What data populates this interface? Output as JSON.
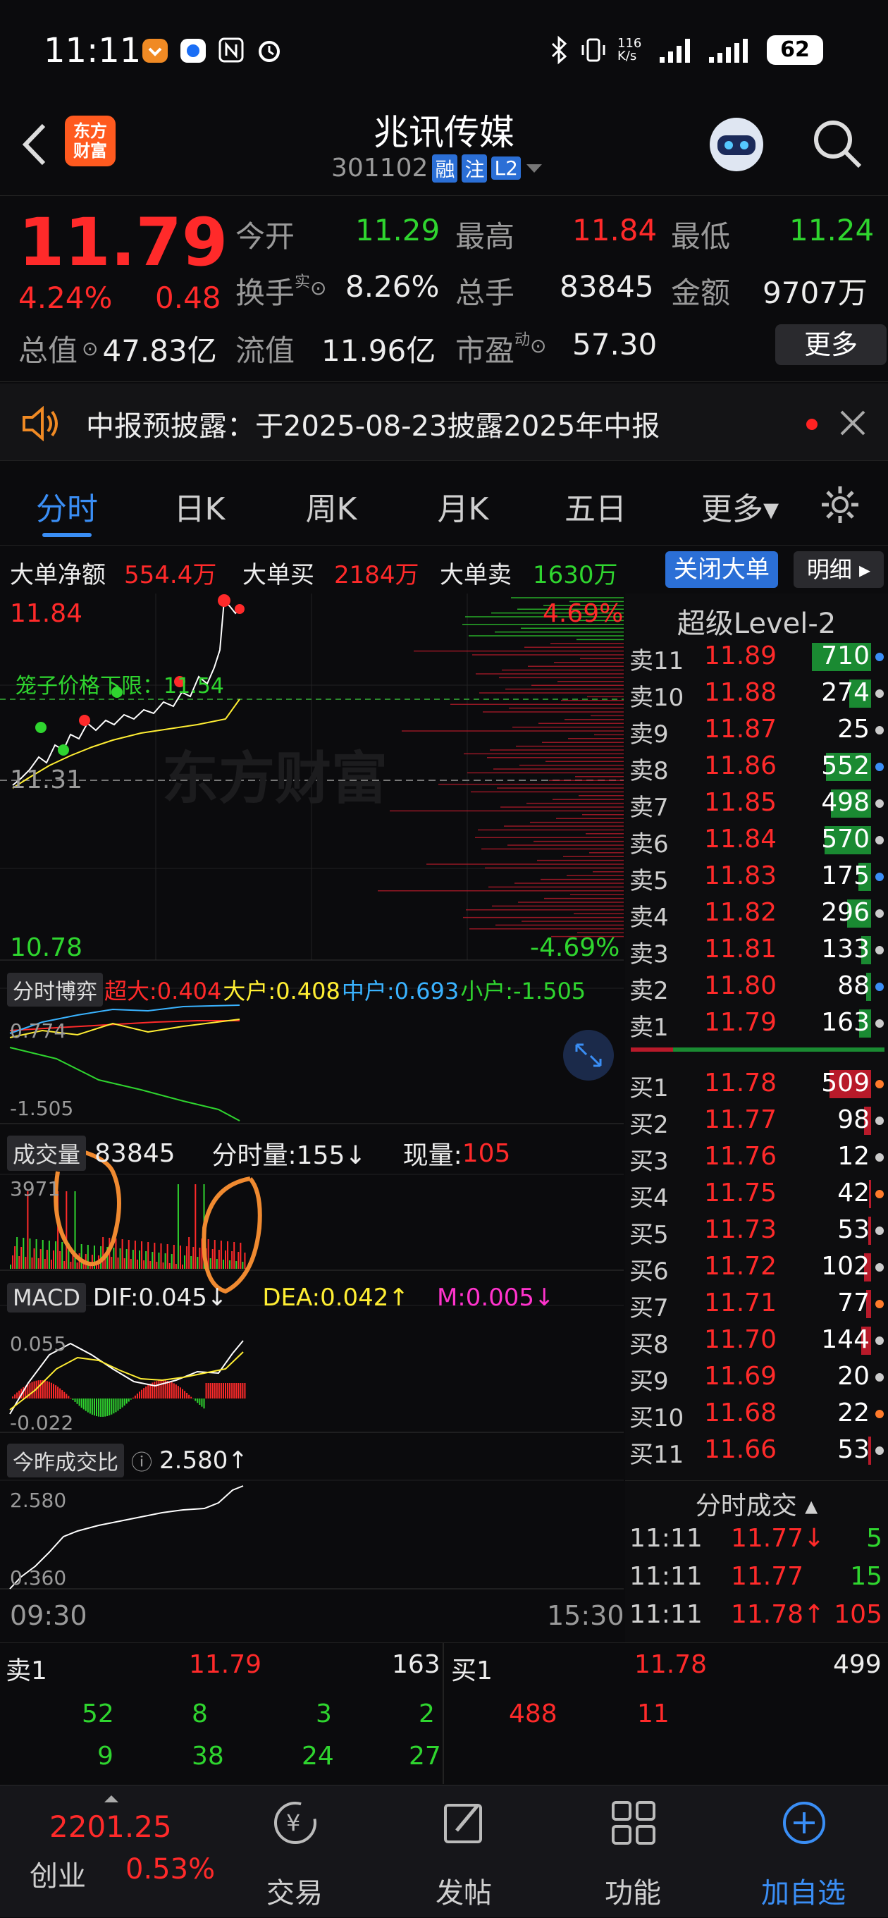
{
  "status": {
    "time": "11:11",
    "net_speed": "116\nK/s",
    "battery": "62"
  },
  "header": {
    "title": "兆讯传媒",
    "code": "301102",
    "tag_margin": "融",
    "tag_note": "注",
    "tag_level": "L2",
    "logo_text_1": "东方",
    "logo_text_2": "财富"
  },
  "quote": {
    "price": "11.79",
    "pct": "4.24%",
    "change": "0.48",
    "open_label": "今开",
    "open": "11.29",
    "high_label": "最高",
    "high": "11.84",
    "low_label": "最低",
    "low": "11.24",
    "turnover_label": "换手",
    "turnover_sup": "实",
    "turnover": "8.26%",
    "volume_label": "总手",
    "volume": "83845",
    "amount_label": "金额",
    "amount": "9707万",
    "mktcap_label": "总值",
    "mktcap": "47.83亿",
    "float_label": "流值",
    "float": "11.96亿",
    "pe_label": "市盈",
    "pe_sup": "动",
    "pe": "57.30",
    "more": "更多"
  },
  "notice": {
    "text": "中报预披露：于2025-08-23披露2025年中报"
  },
  "tabs": [
    "分时",
    "日K",
    "周K",
    "月K",
    "五日",
    "更多▾"
  ],
  "bigorder": {
    "net_label": "大单净额",
    "net": "554.4万",
    "buy_label": "大单买",
    "buy": "2184万",
    "sell_label": "大单卖",
    "sell": "1630万",
    "close_btn": "关闭大单",
    "detail_btn": "明细 ▸"
  },
  "chart": {
    "price_top": "11.84",
    "pct_top": "4.69%",
    "price_bottom": "10.78",
    "pct_bottom": "-4.69%",
    "pre_close": "11.31",
    "cage": "笼子价格下限：11.54",
    "watermark": "东方财富",
    "time_start": "09:30",
    "time_end": "15:30",
    "game_label": "分时博弈",
    "game_super": "超大:0.404",
    "game_big": "大户:0.408",
    "game_mid": "中户:0.693",
    "game_small": "小户:-1.505",
    "game_top": "0.774",
    "game_bottom": "-1.505",
    "vol_label": "成交量",
    "vol_total": "83845",
    "vol_min_label": "分时量:155↓",
    "vol_now_label": "现量:",
    "vol_now": "105",
    "vol_max": "3971",
    "macd_label": "MACD",
    "dif": "DIF:0.045↓",
    "dea": "DEA:0.042↑",
    "m": "M:0.005↓",
    "macd_top": "0.055",
    "macd_bottom": "-0.022",
    "ratio_label": "今昨成交比",
    "ratio": "2.580↑",
    "ratio_top": "2.580",
    "ratio_bottom": "0.360"
  },
  "book": {
    "title": "超级Level-2",
    "asks": [
      {
        "label": "卖11",
        "price": "11.89",
        "vol": "710",
        "pct": 0.6
      },
      {
        "label": "卖10",
        "price": "11.88",
        "vol": "274",
        "pct": 0.22
      },
      {
        "label": "卖9",
        "price": "11.87",
        "vol": "25",
        "pct": 0.0
      },
      {
        "label": "卖8",
        "price": "11.86",
        "vol": "552",
        "pct": 0.46
      },
      {
        "label": "卖7",
        "price": "11.85",
        "vol": "498",
        "pct": 0.41
      },
      {
        "label": "卖6",
        "price": "11.84",
        "vol": "570",
        "pct": 0.47
      },
      {
        "label": "卖5",
        "price": "11.83",
        "vol": "175",
        "pct": 0.13
      },
      {
        "label": "卖4",
        "price": "11.82",
        "vol": "296",
        "pct": 0.24
      },
      {
        "label": "卖3",
        "price": "11.81",
        "vol": "133",
        "pct": 0.1
      },
      {
        "label": "卖2",
        "price": "11.80",
        "vol": "88",
        "pct": 0.05
      },
      {
        "label": "卖1",
        "price": "11.79",
        "vol": "163",
        "pct": 0.12
      }
    ],
    "bids": [
      {
        "label": "买1",
        "price": "11.78",
        "vol": "509",
        "pct": 0.42
      },
      {
        "label": "买2",
        "price": "11.77",
        "vol": "98",
        "pct": 0.07
      },
      {
        "label": "买3",
        "price": "11.76",
        "vol": "12",
        "pct": 0.0
      },
      {
        "label": "买4",
        "price": "11.75",
        "vol": "42",
        "pct": 0.02
      },
      {
        "label": "买5",
        "price": "11.73",
        "vol": "53",
        "pct": 0.03
      },
      {
        "label": "买6",
        "price": "11.72",
        "vol": "102",
        "pct": 0.07
      },
      {
        "label": "买7",
        "price": "11.71",
        "vol": "77",
        "pct": 0.05
      },
      {
        "label": "买8",
        "price": "11.70",
        "vol": "144",
        "pct": 0.1
      },
      {
        "label": "买9",
        "price": "11.69",
        "vol": "20",
        "pct": 0.0
      },
      {
        "label": "买10",
        "price": "11.68",
        "vol": "22",
        "pct": 0.0
      },
      {
        "label": "买11",
        "price": "11.66",
        "vol": "53",
        "pct": 0.03
      }
    ],
    "ticks_title": "分时成交 ▴",
    "ticks": [
      {
        "t": "11:11",
        "p": "11.77↓",
        "v": "5"
      },
      {
        "t": "11:11",
        "p": "11.77",
        "v": "15"
      },
      {
        "t": "11:11",
        "p": "11.78↑",
        "v": "105"
      }
    ]
  },
  "queue": {
    "sell_label": "卖1",
    "sell_price": "11.79",
    "sell_vol": "163",
    "buy_label": "买1",
    "buy_price": "11.78",
    "buy_vol": "499",
    "sell_row1": [
      "52",
      "8",
      "3",
      "2"
    ],
    "sell_row2": [
      "9",
      "38",
      "24",
      "27"
    ],
    "buy_row1": [
      "488",
      "11"
    ]
  },
  "bottomnav": {
    "index_value": "2201.25",
    "index_name": "创业",
    "index_pct": "0.53%",
    "trade": "交易",
    "post": "发帖",
    "func": "功能",
    "watch": "加自选"
  },
  "colors": {
    "up": "#ff2a2a",
    "down": "#2fd52f",
    "accent": "#3a8ef5",
    "bg": "#0b0b0d"
  }
}
